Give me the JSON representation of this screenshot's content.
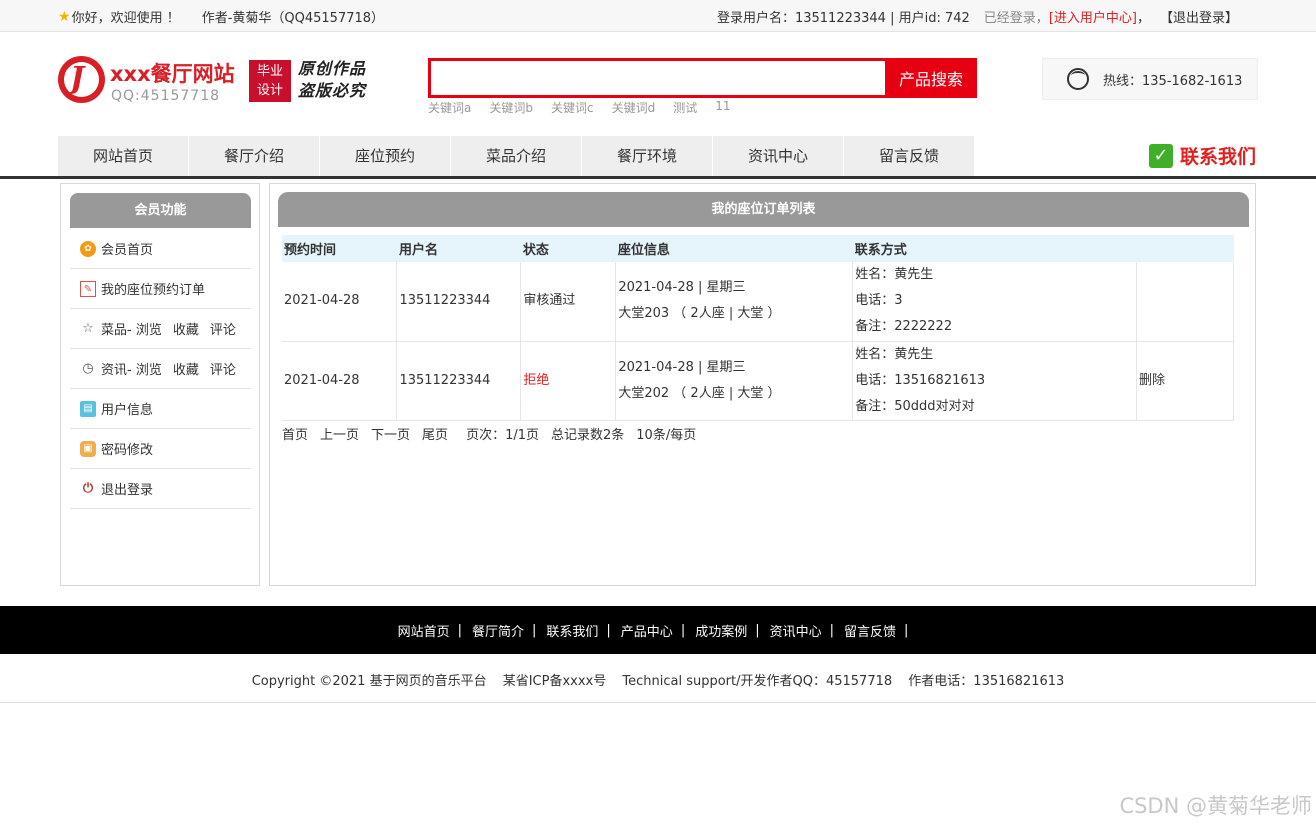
{
  "topbar": {
    "welcome": "你好，欢迎使用 ！",
    "author": "作者-黄菊华（QQ45157718）",
    "login_info": "登录用户名：13511223344 | 用户id: 742",
    "logged_in": "已经登录，",
    "user_center": "[进入用户中心]",
    "comma": "，",
    "logout": "【退出登录】"
  },
  "header": {
    "logo_letter": "J",
    "site_name": "xxx餐厅网站",
    "site_qq": "QQ:45157718",
    "grad_badge": [
      "毕业",
      "设计"
    ],
    "slogan": [
      "原创作品",
      "盗版必究"
    ],
    "search": {
      "value": "",
      "placeholder": "",
      "button": "产品搜索"
    },
    "keywords": [
      "关键词a",
      "关键词b",
      "关键词c",
      "关键词d",
      "测试",
      "11"
    ],
    "hotline": "热线：135-1682-1613"
  },
  "nav": [
    "网站首页",
    "餐厅介绍",
    "座位预约",
    "菜品介绍",
    "餐厅环境",
    "资讯中心",
    "留言反馈"
  ],
  "contact": {
    "check": "✓",
    "label": "联系我们"
  },
  "sidebar": {
    "title": "会员功能",
    "items": [
      {
        "icon": "home-icon",
        "glyph": "✿",
        "label": "会员首页"
      },
      {
        "icon": "edit-icon",
        "glyph": "✎",
        "label": "我的座位预约订单"
      },
      {
        "icon": "star-icon",
        "glyph": "☆",
        "label": "菜品- 浏览",
        "extra1": "收藏",
        "extra2": "评论"
      },
      {
        "icon": "clock-icon",
        "glyph": "◷",
        "label": "资讯- 浏览",
        "extra1": "收藏",
        "extra2": "评论"
      },
      {
        "icon": "user-info-icon",
        "glyph": "▤",
        "label": "用户信息"
      },
      {
        "icon": "lock-icon",
        "glyph": "▣",
        "label": "密码修改"
      },
      {
        "icon": "power-icon",
        "glyph": "⏻",
        "label": "退出登录"
      }
    ]
  },
  "main": {
    "title": "我的座位订单列表",
    "columns": [
      "预约时间",
      "用户名",
      "状态",
      "座位信息",
      "联系方式",
      ""
    ],
    "rows": [
      {
        "time": "2021-04-28",
        "user": "13511223344",
        "status": "审核通过",
        "seat_date": "2021-04-28 | 星期三",
        "seat_place": "大堂203 （ 2人座 | 大堂 ）",
        "name": "姓名：黄先生",
        "phone": "电话：3",
        "note": "备注：2222222",
        "action": ""
      },
      {
        "time": "2021-04-28",
        "user": "13511223344",
        "status": "拒绝",
        "seat_date": "2021-04-28 | 星期三",
        "seat_place": "大堂202 （ 2人座 | 大堂 ）",
        "name": "姓名：黄先生",
        "phone": "电话：13516821613",
        "note": "备注：50ddd对对对",
        "action": "删除"
      }
    ],
    "pager": {
      "first": "首页",
      "prev": "上一页",
      "next": "下一页",
      "last": "尾页",
      "page": "页次：1/1页",
      "total": "总记录数2条",
      "per_page": "10条/每页"
    }
  },
  "footer": {
    "links": [
      "网站首页",
      "餐厅简介",
      "联系我们",
      "产品中心",
      "成功案例",
      "资讯中心",
      "留言反馈"
    ],
    "separator": "|",
    "copyright": "Copyright ©2021 基于网页的音乐平台",
    "icp": "某省ICP备xxxx号",
    "support": "Technical support/开发作者QQ：45157718",
    "phone": "作者电话：13516821613"
  },
  "watermark": "CSDN @黄菊华老师"
}
